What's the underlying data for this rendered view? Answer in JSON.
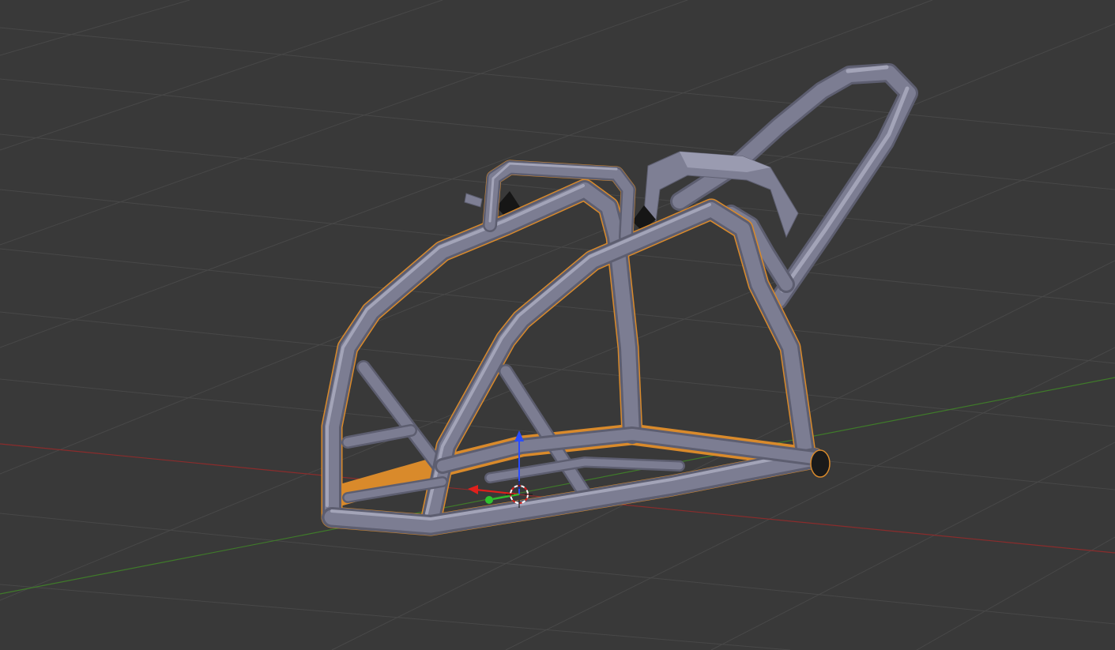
{
  "app": {
    "name": "",
    "view": "3d-viewport"
  },
  "viewport": {
    "background_color": "#393939",
    "grid_color": "#484848",
    "axis_x_color": "#8a2c2c",
    "axis_y_color": "#3f7a2a",
    "selection_outline_color": "#d98a2b",
    "object_color": "#7c7d92",
    "object": {
      "type": "tube-frame",
      "selected": true
    },
    "gizmo": {
      "z_axis_color": "#2a4cff",
      "x_axis_color": "#e0201c",
      "y_axis_color": "#2ec32e"
    },
    "cursor_icon": "3d-cursor-icon"
  }
}
